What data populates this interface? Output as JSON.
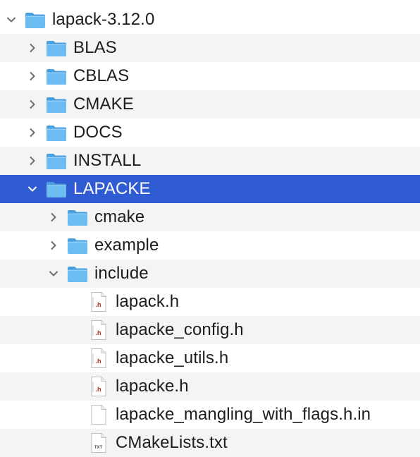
{
  "tree": {
    "rows": [
      {
        "label": "lapack-3.12.0",
        "type": "folder",
        "level": 0,
        "expanded": true,
        "selected": false
      },
      {
        "label": "BLAS",
        "type": "folder",
        "level": 1,
        "expanded": false,
        "selected": false
      },
      {
        "label": "CBLAS",
        "type": "folder",
        "level": 1,
        "expanded": false,
        "selected": false
      },
      {
        "label": "CMAKE",
        "type": "folder",
        "level": 1,
        "expanded": false,
        "selected": false
      },
      {
        "label": "DOCS",
        "type": "folder",
        "level": 1,
        "expanded": false,
        "selected": false
      },
      {
        "label": "INSTALL",
        "type": "folder",
        "level": 1,
        "expanded": false,
        "selected": false
      },
      {
        "label": "LAPACKE",
        "type": "folder",
        "level": 1,
        "expanded": true,
        "selected": true
      },
      {
        "label": "cmake",
        "type": "folder",
        "level": 2,
        "expanded": false,
        "selected": false
      },
      {
        "label": "example",
        "type": "folder",
        "level": 2,
        "expanded": false,
        "selected": false
      },
      {
        "label": "include",
        "type": "folder",
        "level": 2,
        "expanded": true,
        "selected": false
      },
      {
        "label": "lapack.h",
        "type": "h-file",
        "level": 3,
        "selected": false
      },
      {
        "label": "lapacke_config.h",
        "type": "h-file",
        "level": 3,
        "selected": false
      },
      {
        "label": "lapacke_utils.h",
        "type": "h-file",
        "level": 3,
        "selected": false
      },
      {
        "label": "lapacke.h",
        "type": "h-file",
        "level": 3,
        "selected": false
      },
      {
        "label": "lapacke_mangling_with_flags.h.in",
        "type": "blank-file",
        "level": 3,
        "selected": false
      },
      {
        "label": "CMakeLists.txt",
        "type": "txt-file",
        "level": 3,
        "selected": false
      }
    ]
  },
  "icons": {
    "h_badge": ".h",
    "txt_badge": "TXT"
  },
  "colors": {
    "selection": "#2f5bd3",
    "alt_row": "#f4f4f5",
    "folder": "#5aaeea",
    "text": "#1d1d1f"
  }
}
